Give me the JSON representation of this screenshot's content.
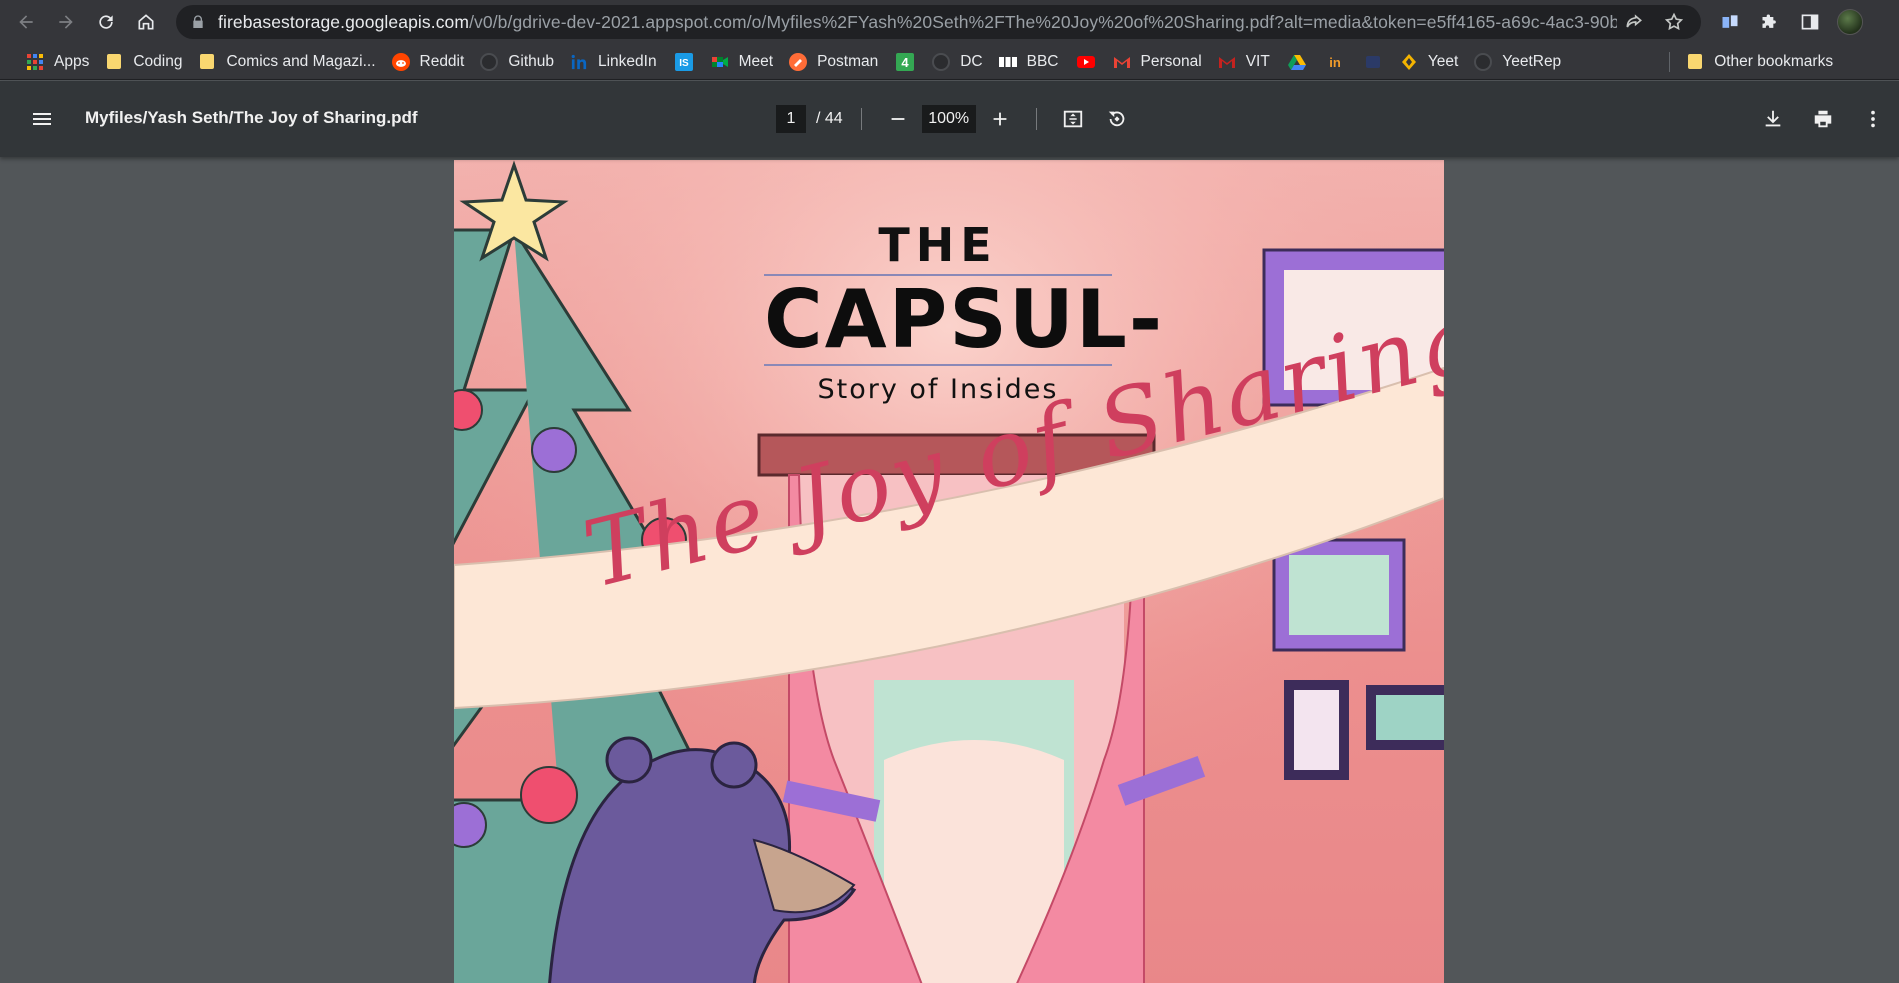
{
  "browser": {
    "url_host": "firebasestorage.googleapis.com",
    "url_path": "/v0/b/gdrive-dev-2021.appspot.com/o/Myfiles%2FYash%20Seth%2FThe%20Joy%20of%20Sharing.pdf?alt=media&token=e5ff4165-a69c-4ac3-90b1..."
  },
  "bookmarks": [
    {
      "label": "Apps"
    },
    {
      "label": "Coding"
    },
    {
      "label": "Comics and Magazi..."
    },
    {
      "label": "Reddit"
    },
    {
      "label": "Github"
    },
    {
      "label": "LinkedIn"
    },
    {
      "label": "Meet"
    },
    {
      "label": "Postman"
    },
    {
      "label": "DC"
    },
    {
      "label": "BBC"
    },
    {
      "label": "Personal"
    },
    {
      "label": "VIT"
    },
    {
      "label": "Yeet"
    },
    {
      "label": "YeetRep"
    },
    {
      "label": "Other bookmarks"
    }
  ],
  "pdf": {
    "title": "Myfiles/Yash Seth/The Joy of Sharing.pdf",
    "current_page": "1",
    "total_pages": "/ 44",
    "zoom": "100%"
  },
  "cover": {
    "brand_the": "THE",
    "brand_name": "CAPSUL-",
    "tagline": "Story of Insides",
    "title": "The Joy of Sharing"
  },
  "colors": {
    "browser_bg": "#35363a",
    "toolbar_bg": "#323639",
    "viewer_bg": "#525659",
    "cover_title": "#cf3f5e"
  }
}
